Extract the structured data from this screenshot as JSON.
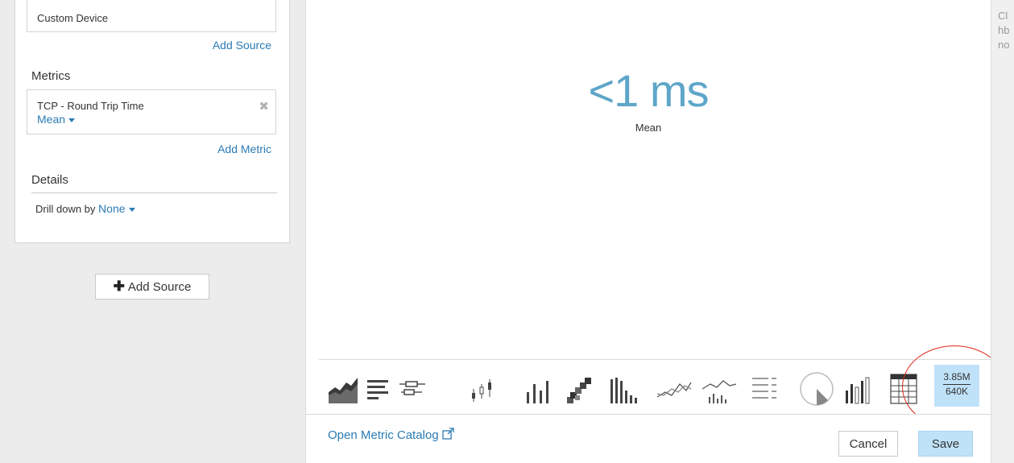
{
  "left": {
    "device_name": "Custom Device",
    "add_source_link": "Add Source",
    "metrics_title": "Metrics",
    "metric": {
      "name": "TCP - Round Trip Time",
      "aggregation": "Mean"
    },
    "add_metric_link": "Add Metric",
    "details_title": "Details",
    "drill_label": "Drill down by",
    "drill_value": "None",
    "add_source_button": "Add Source"
  },
  "preview": {
    "value": "<1 ms",
    "label": "Mean"
  },
  "viz": {
    "icons": [
      "area-chart-icon",
      "list-chart-icon",
      "box-plot-icon",
      "candlestick-icon",
      "column-chart-icon",
      "heatmap-icon",
      "histogram-icon",
      "line-chart-icon",
      "line-column-icon",
      "status-list-icon",
      "pie-chart-icon",
      "bar-chart-icon",
      "table-chart-icon",
      "value-chart-icon"
    ],
    "selected": {
      "top_value": "3.85M",
      "bottom_value": "640K"
    }
  },
  "footer": {
    "catalog_link": "Open Metric Catalog",
    "cancel": "Cancel",
    "save": "Save"
  },
  "background_fragments": [
    "Cl",
    "hb",
    "no"
  ],
  "colors": {
    "accent": "#2b7bb4",
    "value": "#5ea6c9",
    "selected_bg": "#bfe2f8",
    "highlight": "#e0271a"
  }
}
